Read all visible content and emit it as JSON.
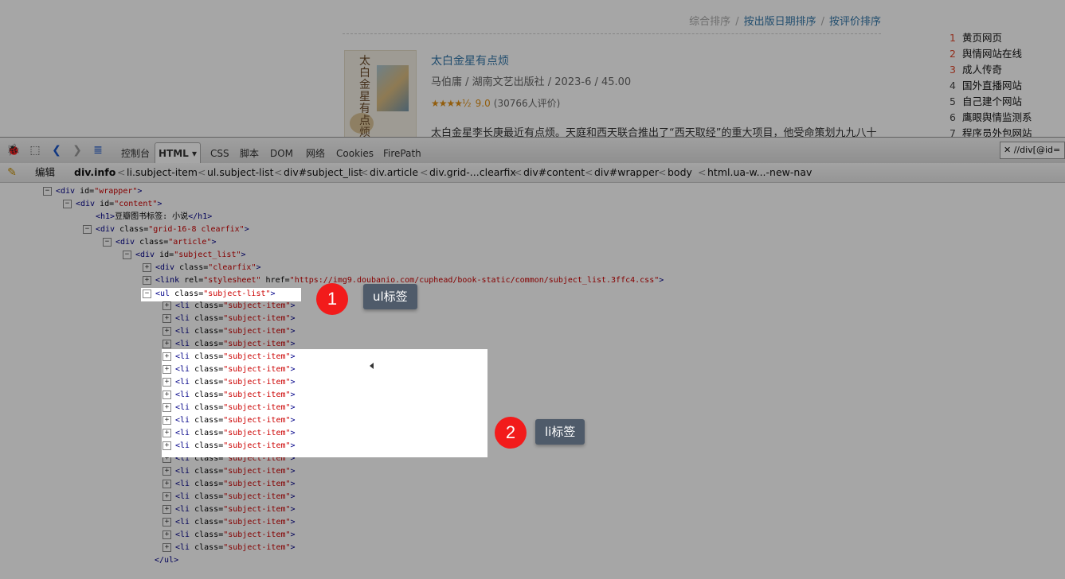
{
  "webpage": {
    "sort": {
      "active": "综合排序",
      "sep": "/",
      "by_date": "按出版日期排序",
      "by_rating": "按评价排序"
    },
    "book": {
      "cover_title": "太白金星有点烦",
      "title": "太白金星有点烦",
      "pub": "马伯庸 / 湖南文艺出版社 / 2023-6 / 45.00",
      "stars": "★★★★½",
      "score": "9.0",
      "reviews": "(30766人评价)",
      "desc": "太白金星李长庚最近有点烦。天庭和西天联合推出了“西天取经”的重大项目，他受命策划九九八十"
    },
    "ranking": [
      {
        "num": "1",
        "text": "黄页网页"
      },
      {
        "num": "2",
        "text": "舆情网站在线"
      },
      {
        "num": "3",
        "text": "成人传奇"
      },
      {
        "num": "4",
        "text": "国外直播网站"
      },
      {
        "num": "5",
        "text": "自己建个网站"
      },
      {
        "num": "6",
        "text": "鹰眼舆情监测系"
      },
      {
        "num": "7",
        "text": "程序员外包网站"
      }
    ]
  },
  "toolbar": {
    "tabs": [
      "控制台",
      "HTML ▾",
      "CSS",
      "脚本",
      "DOM",
      "网络",
      "Cookies",
      "FirePath"
    ],
    "xpath": "//div[@id="
  },
  "crumbbar": {
    "edit": "编辑",
    "crumbs": [
      "div.info",
      "li.subject-item",
      "ul.subject-list",
      "div#subject_list",
      "div.article",
      "div.grid-...clearfix",
      "div#content",
      "div#wrapper",
      "body",
      "html.ua-w...-new-nav"
    ]
  },
  "tree": {
    "wrapper_id": "wrapper",
    "content_id": "content",
    "h1_text": "豆瓣图书标签: 小说",
    "grid_class": "grid-16-8 clearfix",
    "article_class": "article",
    "subject_list_id": "subject_list",
    "clearfix_class": "clearfix",
    "link_rel": "stylesheet",
    "link_href": "https://img9.doubanio.com/cuphead/book-static/common/subject_list.3ffc4.css",
    "ul_class": "subject-list",
    "li_class": "subject-item",
    "ul_close": "</ul>"
  },
  "annotations": {
    "badge1": "1",
    "label1": "ul标签",
    "badge2": "2",
    "label2": "li标签"
  }
}
